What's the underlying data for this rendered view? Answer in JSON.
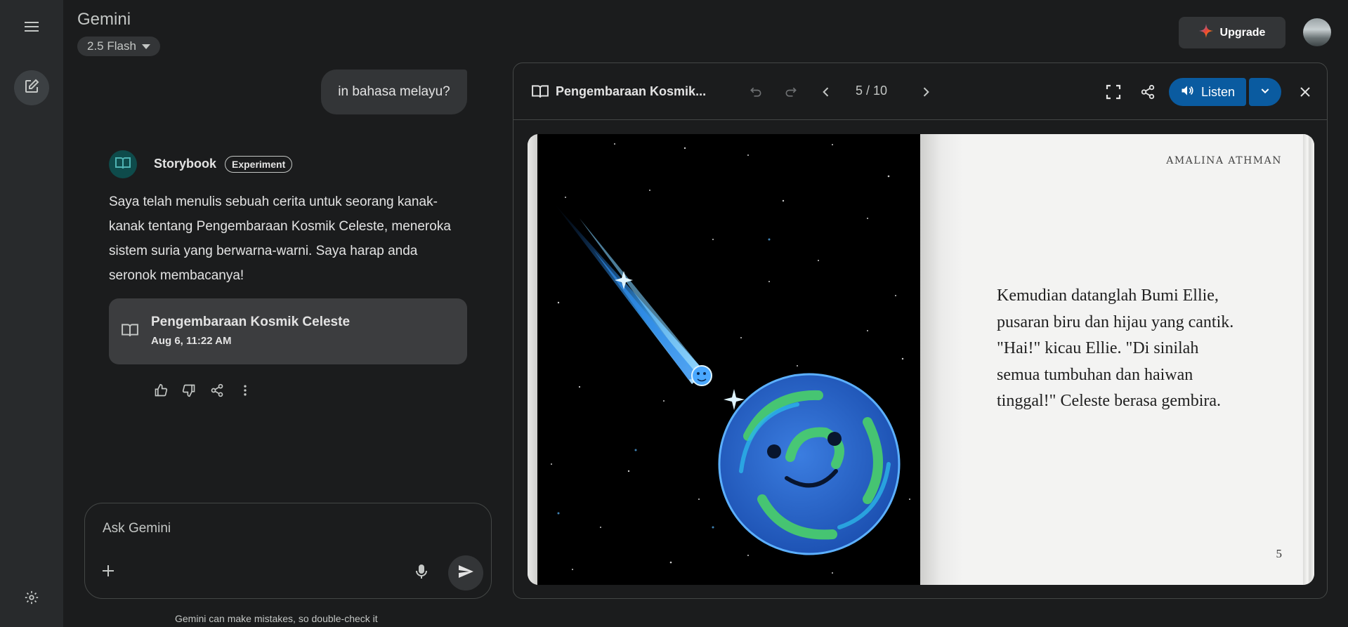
{
  "header": {
    "brand": "Gemini",
    "model": "2.5 Flash",
    "upgrade_label": "Upgrade"
  },
  "chat": {
    "user_message": "in bahasa melayu?",
    "agent_name": "Storybook",
    "agent_badge": "Experiment",
    "reply": "Saya telah menulis sebuah cerita untuk seorang kanak-kanak tentang Pengembaraan Kosmik Celeste, meneroka sistem suria yang berwarna-warni. Saya harap anda seronok membacanya!",
    "story_card": {
      "title": "Pengembaraan Kosmik Celeste",
      "date": "Aug 6, 11:22 AM"
    }
  },
  "input": {
    "placeholder": "Ask Gemini",
    "disclaimer": "Gemini can make mistakes, so double-check it"
  },
  "viewer": {
    "title": "Pengembaraan Kosmik...",
    "pager": "5 / 10",
    "listen_label": "Listen",
    "accent": "#0a5ba0"
  },
  "book": {
    "author": "AMALINA ATHMAN",
    "text": "Kemudian datanglah Bumi Ellie, pusaran biru dan hijau yang cantik. \"Hai!\" kicau Ellie. \"Di sinilah semua tumbuhan dan haiwan tinggal!\" Celeste berasa gembira.",
    "page_number": "5"
  },
  "icons": [
    "menu-icon",
    "edit-icon",
    "settings-icon",
    "sparkle-icon",
    "book-icon",
    "thumbs-up-icon",
    "thumbs-down-icon",
    "share-icon",
    "more-icon",
    "plus-icon",
    "mic-icon",
    "send-icon",
    "undo-icon",
    "redo-icon",
    "chevron-left-icon",
    "chevron-right-icon",
    "fullscreen-icon",
    "volume-icon",
    "chevron-down-icon",
    "close-icon"
  ]
}
